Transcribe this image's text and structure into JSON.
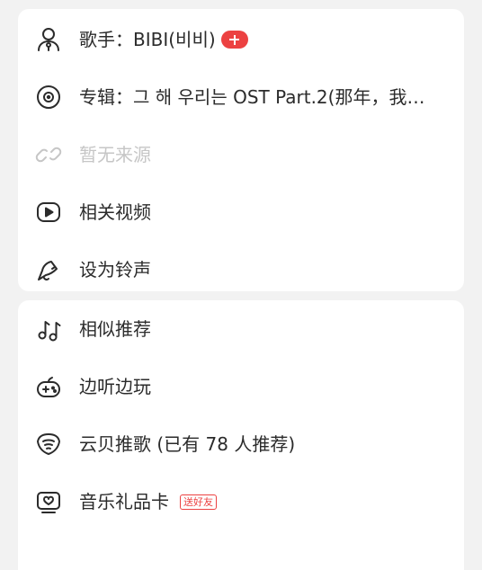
{
  "song_menu": {
    "section1": [
      {
        "id": "artist",
        "prefix": "歌手：",
        "text": "BIBI(비비)",
        "badge_icon": "plus-icon",
        "icon": "artist-icon"
      },
      {
        "id": "album",
        "prefix": "专辑：",
        "text": "그 해 우리는 OST Part.2(那年，我们…",
        "icon": "album-icon"
      },
      {
        "id": "source",
        "text": "暂无来源",
        "disabled": true,
        "icon": "link-icon"
      },
      {
        "id": "related-videos",
        "text": "相关视频",
        "icon": "play-icon"
      },
      {
        "id": "set-ringtone",
        "text": "设为铃声",
        "icon": "bell-icon"
      }
    ],
    "section2": [
      {
        "id": "similar",
        "text": "相似推荐",
        "icon": "music-notes-icon"
      },
      {
        "id": "listen-play",
        "text": "边听边玩",
        "icon": "gamepad-icon"
      },
      {
        "id": "yunbei",
        "text": "云贝推歌 (已有 78 人推荐)",
        "icon": "yunbei-icon"
      },
      {
        "id": "gift-card",
        "text": "音乐礼品卡",
        "tag": "送好友",
        "icon": "gift-card-icon"
      }
    ]
  },
  "colors": {
    "accent": "#ec4141",
    "text": "#2b2b2b",
    "disabled": "#c6c6c6",
    "background": "#f2f2f2",
    "card": "#ffffff"
  }
}
